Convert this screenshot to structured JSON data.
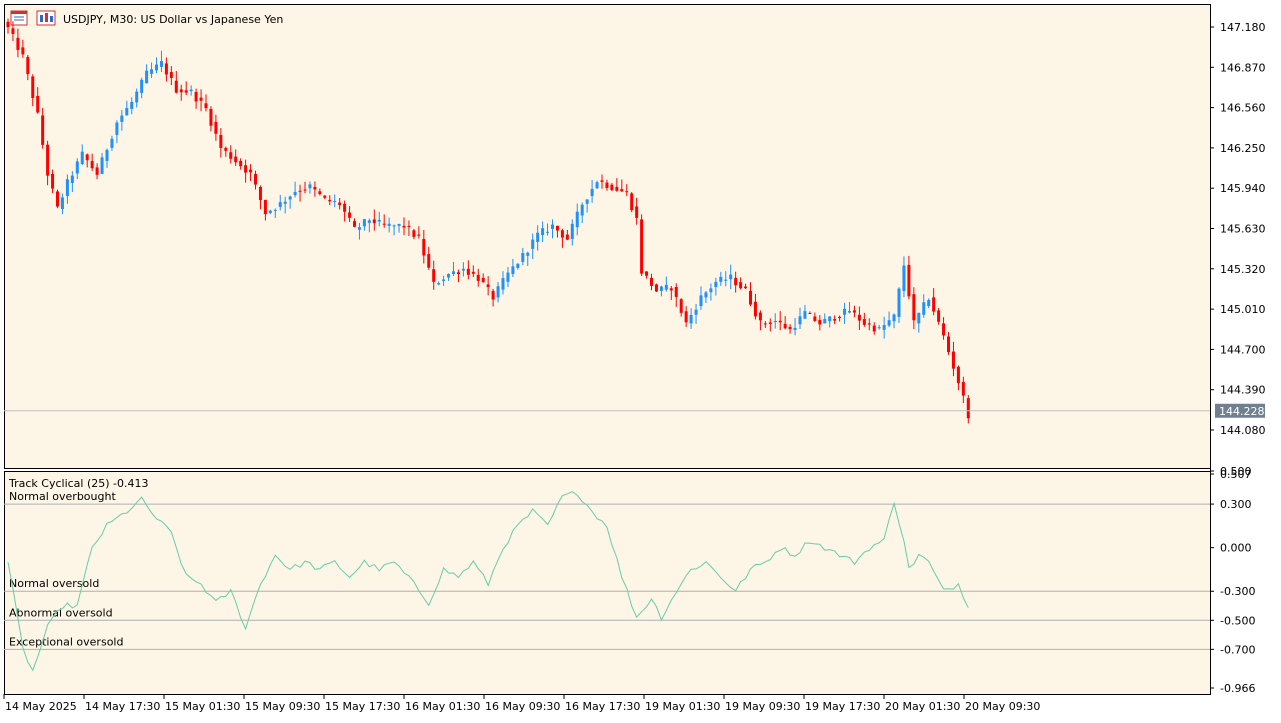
{
  "header": {
    "symbol_title": "USDJPY, M30:  US Dollar vs Japanese Yen",
    "icons": [
      "chart-window-icon",
      "chart-properties-icon"
    ]
  },
  "colors": {
    "background": "#fdf5e6",
    "bull_candle": "#1e90ff",
    "bear_candle": "#ff0000",
    "indicator_line": "#66cdaa",
    "price_line": "#c0c0c0",
    "price_label_bg": "#708090"
  },
  "price_panel": {
    "current_price": "144.228",
    "y_ticks": [
      "147.180",
      "146.870",
      "146.560",
      "146.250",
      "145.940",
      "145.630",
      "145.320",
      "145.010",
      "144.700",
      "144.390",
      "144.080"
    ]
  },
  "indicator_panel": {
    "title": "Track Cyclical (25) -0.413",
    "y_ticks": [
      "0.500",
      "0.507",
      "0.300",
      "0.000",
      "-0.300",
      "-0.500",
      "-0.700",
      "-0.966"
    ],
    "levels": [
      {
        "label": "Normal overbought",
        "value": 0.3
      },
      {
        "label": "Normal oversold",
        "value": -0.3
      },
      {
        "label": "Abnormal oversold",
        "value": -0.5
      },
      {
        "label": "Exceptional oversold",
        "value": -0.7
      }
    ]
  },
  "time_axis": {
    "labels": [
      "14 May 2025",
      "14 May 17:30",
      "15 May 01:30",
      "15 May 09:30",
      "15 May 17:30",
      "16 May 01:30",
      "16 May 09:30",
      "16 May 17:30",
      "19 May 01:30",
      "19 May 09:30",
      "19 May 17:30",
      "20 May 01:30",
      "20 May 09:30"
    ]
  },
  "chart_data": [
    {
      "type": "candlestick",
      "title": "USDJPY, M30:  US Dollar vs Japanese Yen",
      "ylim": [
        143.94,
        147.28
      ],
      "anchors": [
        [
          0,
          147.17
        ],
        [
          3,
          146.95
        ],
        [
          6,
          146.5
        ],
        [
          8,
          146.05
        ],
        [
          10,
          145.78
        ],
        [
          12,
          145.98
        ],
        [
          15,
          146.2
        ],
        [
          18,
          146.05
        ],
        [
          22,
          146.45
        ],
        [
          25,
          146.6
        ],
        [
          28,
          146.82
        ],
        [
          31,
          146.9
        ],
        [
          34,
          146.7
        ],
        [
          37,
          146.68
        ],
        [
          40,
          146.55
        ],
        [
          43,
          146.25
        ],
        [
          46,
          146.15
        ],
        [
          49,
          146.05
        ],
        [
          52,
          145.75
        ],
        [
          55,
          145.82
        ],
        [
          58,
          145.92
        ],
        [
          61,
          145.95
        ],
        [
          64,
          145.85
        ],
        [
          67,
          145.82
        ],
        [
          70,
          145.62
        ],
        [
          73,
          145.7
        ],
        [
          76,
          145.65
        ],
        [
          80,
          145.65
        ],
        [
          83,
          145.55
        ],
        [
          86,
          145.2
        ],
        [
          89,
          145.28
        ],
        [
          92,
          145.32
        ],
        [
          95,
          145.25
        ],
        [
          98,
          145.1
        ],
        [
          101,
          145.28
        ],
        [
          104,
          145.42
        ],
        [
          107,
          145.58
        ],
        [
          110,
          145.65
        ],
        [
          113,
          145.55
        ],
        [
          116,
          145.82
        ],
        [
          119,
          146.0
        ],
        [
          122,
          145.95
        ],
        [
          125,
          145.9
        ],
        [
          127,
          145.7
        ],
        [
          128,
          145.3
        ],
        [
          131,
          145.15
        ],
        [
          134,
          145.18
        ],
        [
          137,
          144.9
        ],
        [
          140,
          145.1
        ],
        [
          143,
          145.22
        ],
        [
          146,
          145.25
        ],
        [
          149,
          145.15
        ],
        [
          152,
          144.9
        ],
        [
          155,
          144.92
        ],
        [
          158,
          144.85
        ],
        [
          161,
          144.98
        ],
        [
          164,
          144.9
        ],
        [
          167,
          144.95
        ],
        [
          170,
          145.0
        ],
        [
          173,
          144.9
        ],
        [
          176,
          144.85
        ],
        [
          179,
          144.95
        ],
        [
          181,
          145.35
        ],
        [
          183,
          144.9
        ],
        [
          186,
          145.1
        ],
        [
          189,
          144.8
        ],
        [
          192,
          144.45
        ],
        [
          194,
          144.2
        ]
      ]
    },
    {
      "type": "line",
      "title": "Track Cyclical (25) -0.413",
      "ylim": [
        -0.966,
        0.507
      ],
      "anchors": [
        [
          0,
          -0.1
        ],
        [
          3,
          -0.7
        ],
        [
          5,
          -0.85
        ],
        [
          8,
          -0.55
        ],
        [
          11,
          -0.4
        ],
        [
          14,
          -0.4
        ],
        [
          17,
          0.0
        ],
        [
          20,
          0.15
        ],
        [
          24,
          0.25
        ],
        [
          27,
          0.33
        ],
        [
          30,
          0.2
        ],
        [
          33,
          0.1
        ],
        [
          36,
          -0.2
        ],
        [
          39,
          -0.25
        ],
        [
          42,
          -0.38
        ],
        [
          45,
          -0.3
        ],
        [
          48,
          -0.55
        ],
        [
          51,
          -0.25
        ],
        [
          54,
          -0.05
        ],
        [
          57,
          -0.15
        ],
        [
          60,
          -0.1
        ],
        [
          63,
          -0.15
        ],
        [
          66,
          -0.1
        ],
        [
          69,
          -0.2
        ],
        [
          72,
          -0.1
        ],
        [
          75,
          -0.15
        ],
        [
          78,
          -0.1
        ],
        [
          82,
          -0.25
        ],
        [
          85,
          -0.38
        ],
        [
          88,
          -0.15
        ],
        [
          91,
          -0.2
        ],
        [
          94,
          -0.1
        ],
        [
          97,
          -0.25
        ],
        [
          100,
          0.0
        ],
        [
          103,
          0.15
        ],
        [
          106,
          0.25
        ],
        [
          109,
          0.15
        ],
        [
          112,
          0.35
        ],
        [
          115,
          0.38
        ],
        [
          118,
          0.25
        ],
        [
          121,
          0.15
        ],
        [
          124,
          -0.2
        ],
        [
          127,
          -0.48
        ],
        [
          130,
          -0.35
        ],
        [
          132,
          -0.48
        ],
        [
          135,
          -0.3
        ],
        [
          138,
          -0.15
        ],
        [
          141,
          -0.1
        ],
        [
          144,
          -0.2
        ],
        [
          147,
          -0.3
        ],
        [
          150,
          -0.15
        ],
        [
          153,
          -0.1
        ],
        [
          156,
          0.0
        ],
        [
          159,
          -0.05
        ],
        [
          162,
          0.05
        ],
        [
          165,
          0.0
        ],
        [
          168,
          -0.05
        ],
        [
          171,
          -0.1
        ],
        [
          174,
          0.0
        ],
        [
          177,
          0.05
        ],
        [
          179,
          0.32
        ],
        [
          181,
          0.05
        ],
        [
          182,
          -0.15
        ],
        [
          184,
          -0.05
        ],
        [
          186,
          -0.1
        ],
        [
          189,
          -0.3
        ],
        [
          192,
          -0.25
        ],
        [
          194,
          -0.413
        ]
      ]
    }
  ]
}
